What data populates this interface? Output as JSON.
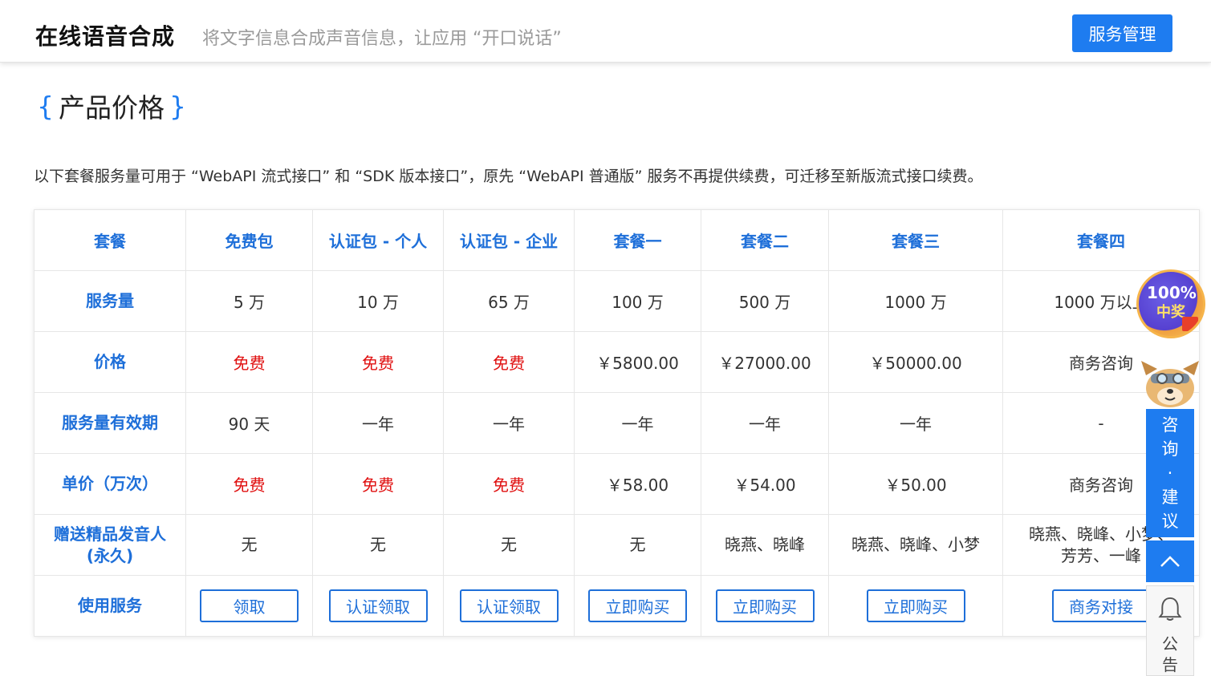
{
  "header": {
    "title": "在线语音合成",
    "subtitle": "将文字信息合成声音信息，让应用 “开口说话”",
    "manage_button": "服务管理"
  },
  "section": {
    "brace_open": "{",
    "title": "产品价格",
    "brace_close": "}"
  },
  "intro": "以下套餐服务量可用于 “WebAPI 流式接口” 和 “SDK 版本接口”，原先 “WebAPI 普通版” 服务不再提供续费，可迁移至新版流式接口续费。",
  "table": {
    "headers": [
      "套餐",
      "免费包",
      "认证包 - 个人",
      "认证包 - 企业",
      "套餐一",
      "套餐二",
      "套餐三",
      "套餐四"
    ],
    "rows": {
      "volume": {
        "label": "服务量",
        "cells": [
          "5 万",
          "10 万",
          "65 万",
          "100 万",
          "500 万",
          "1000 万",
          "1000 万以上"
        ]
      },
      "price": {
        "label": "价格",
        "cells": [
          "免费",
          "免费",
          "免费",
          "￥5800.00",
          "￥27000.00",
          "￥50000.00",
          "商务咨询"
        ]
      },
      "validity": {
        "label": "服务量有效期",
        "cells": [
          "90 天",
          "一年",
          "一年",
          "一年",
          "一年",
          "一年",
          "-"
        ]
      },
      "unit_price": {
        "label": "单价（万次）",
        "cells": [
          "免费",
          "免费",
          "免费",
          "￥58.00",
          "￥54.00",
          "￥50.00",
          "商务咨询"
        ]
      },
      "gift": {
        "label_line1": "赠送精品发音人",
        "label_line2": "(永久)",
        "cells": [
          "无",
          "无",
          "无",
          "无",
          "晓燕、晓峰",
          "晓燕、晓峰、小梦"
        ],
        "last_line1": "晓燕、晓峰、小梦、",
        "last_line2": "芳芳、一峰"
      },
      "service": {
        "label": "使用服务",
        "buttons": [
          "领取",
          "认证领取",
          "认证领取",
          "立即购买",
          "立即购买",
          "立即购买",
          "商务对接"
        ]
      }
    }
  },
  "widgets": {
    "badge_line1": "100%",
    "badge_line2": "中奖",
    "consult_chars": [
      "咨",
      "询",
      "·",
      "建",
      "议"
    ],
    "notice_label": "公告",
    "up_icon": "chevron-up-icon",
    "bell_icon": "bell-icon"
  },
  "colors": {
    "accent": "#1e7cf0",
    "free_text": "#e01010"
  }
}
